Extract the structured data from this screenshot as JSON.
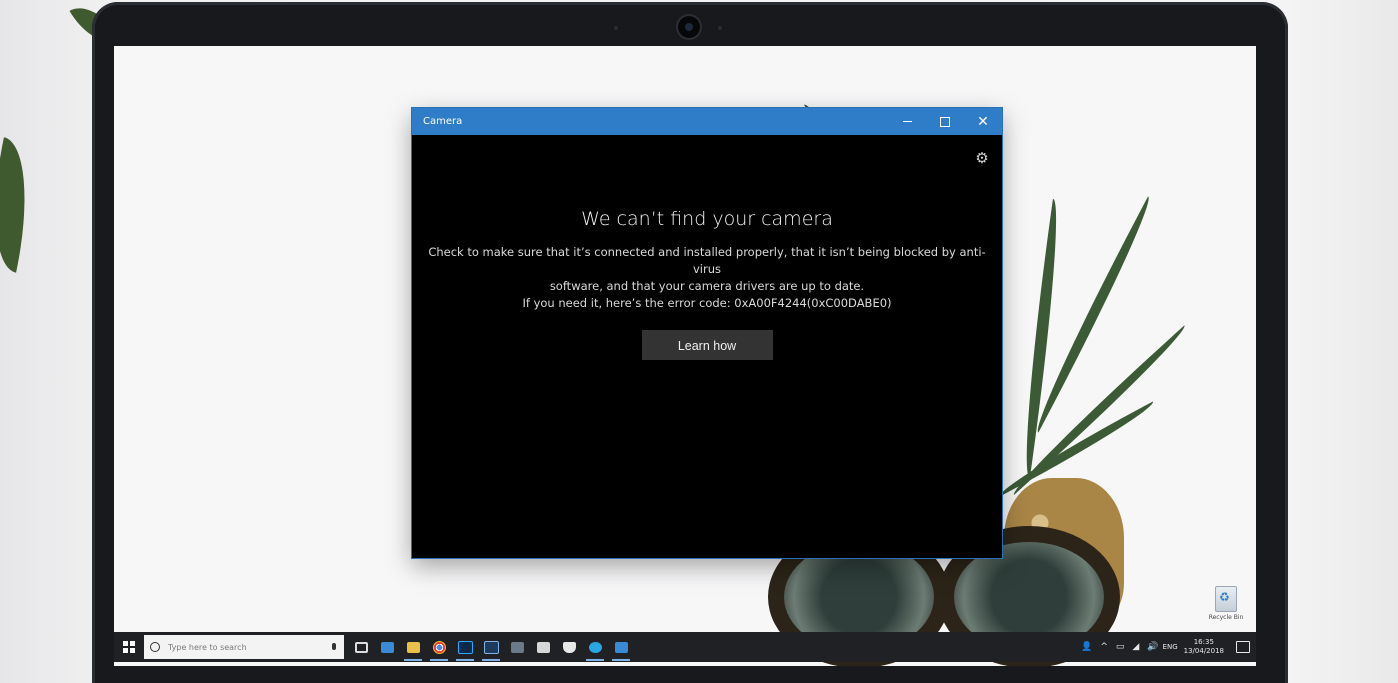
{
  "window": {
    "title": "Camera",
    "controls": {
      "minimize": "minimize",
      "maximize": "maximize",
      "close": "close"
    },
    "settings_icon": "gear-icon"
  },
  "error": {
    "heading": "We can’t find your camera",
    "line1": "Check to make sure that it’s connected and installed properly, that it isn’t being blocked by anti-virus",
    "line2": "software, and that your camera drivers are up to date.",
    "line3": "If you need it, here’s the error code: 0xA00F4244(0xC00DABE0)",
    "button_label": "Learn how"
  },
  "desktop": {
    "recycle_bin_label": "Recycle Bin"
  },
  "taskbar": {
    "search_placeholder": "Type here to search",
    "pinned_icons": [
      "task-view-icon",
      "store-icon",
      "file-explorer-icon",
      "chrome-icon",
      "photoshop-icon",
      "word-icon",
      "outlook-icon",
      "calendar-icon",
      "shield-icon",
      "skype-icon",
      "word-doc-icon"
    ],
    "tray": {
      "language": "ENG",
      "time": "16:35",
      "date": "13/04/2018"
    }
  },
  "colors": {
    "titlebar": "#2f7dc9",
    "window_bg": "#000000",
    "button_bg": "#333333",
    "taskbar_bg": "#1f2124"
  }
}
